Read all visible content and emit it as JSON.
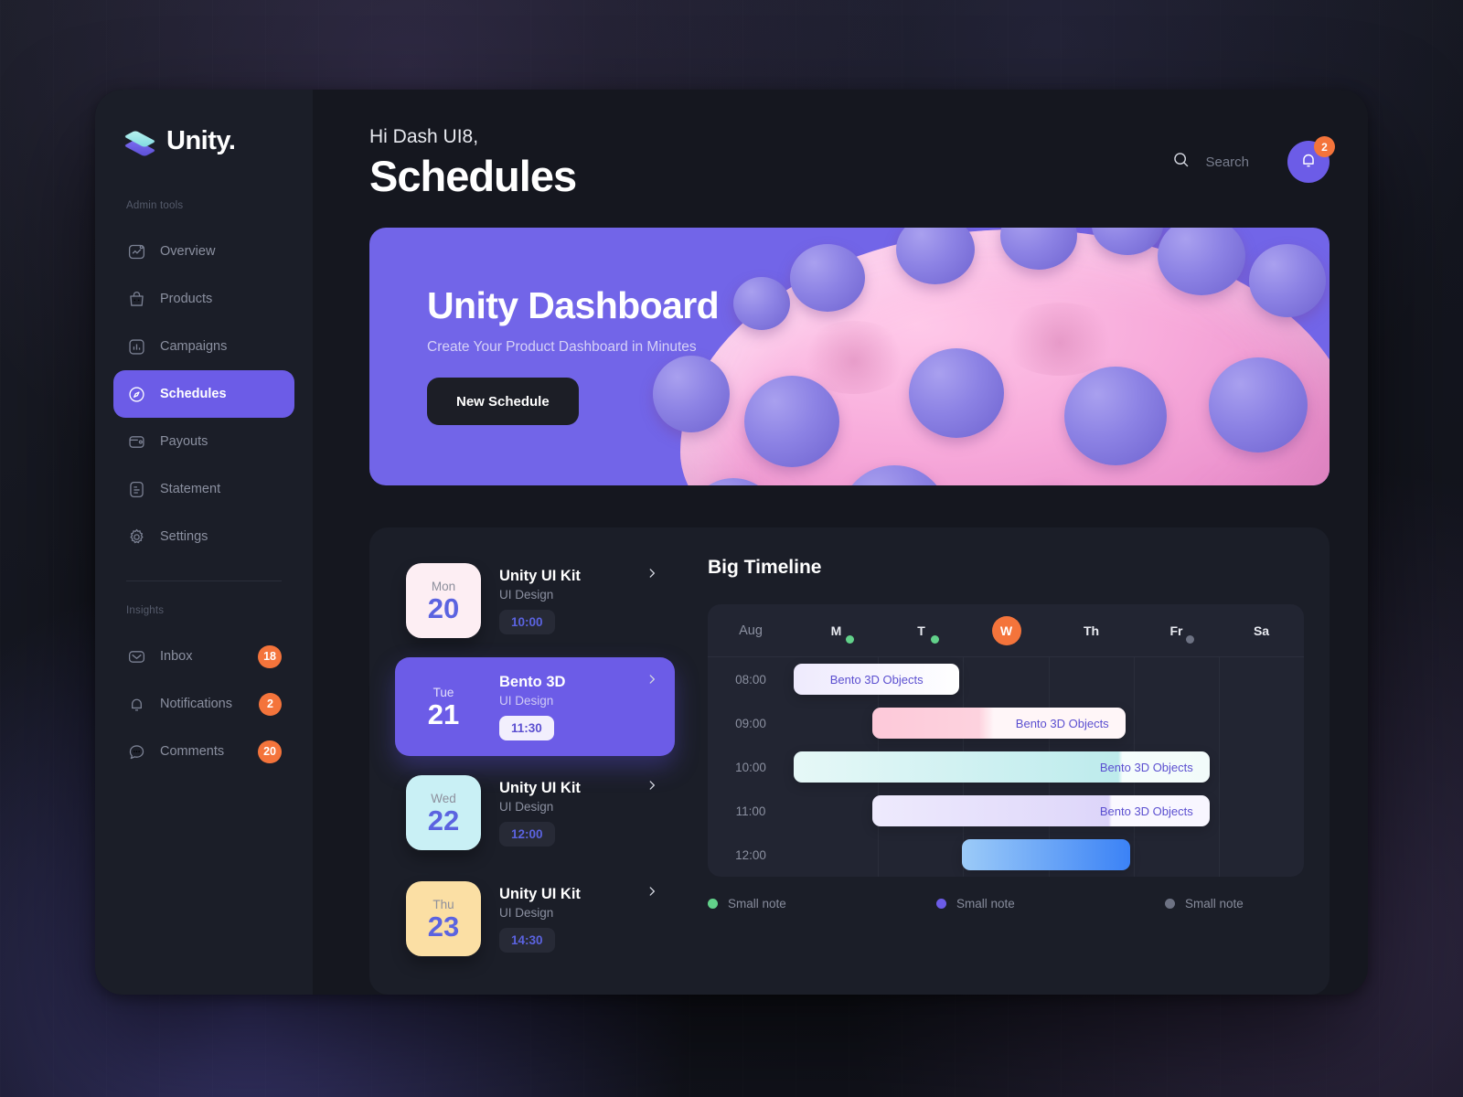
{
  "brand": {
    "name": "Unity.",
    "logo_icon": "layers-icon"
  },
  "sidebar": {
    "admin_label": "Admin tools",
    "admin_items": [
      {
        "label": "Overview",
        "icon": "chart-frame-icon",
        "active": false
      },
      {
        "label": "Products",
        "icon": "bag-icon",
        "active": false
      },
      {
        "label": "Campaigns",
        "icon": "bar-chart-icon",
        "active": false
      },
      {
        "label": "Schedules",
        "icon": "compass-icon",
        "active": true
      },
      {
        "label": "Payouts",
        "icon": "wallet-icon",
        "active": false
      },
      {
        "label": "Statement",
        "icon": "document-icon",
        "active": false
      },
      {
        "label": "Settings",
        "icon": "gear-icon",
        "active": false
      }
    ],
    "insights_label": "Insights",
    "insights_items": [
      {
        "label": "Inbox",
        "icon": "envelope-icon",
        "badge": "18"
      },
      {
        "label": "Notifications",
        "icon": "bell-icon",
        "badge": "2"
      },
      {
        "label": "Comments",
        "icon": "chat-icon",
        "badge": "20"
      }
    ]
  },
  "header": {
    "greeting": "Hi Dash UI8,",
    "title": "Schedules",
    "search_placeholder": "Search",
    "notification_count": "2"
  },
  "hero": {
    "title": "Unity Dashboard",
    "subtitle": "Create Your Product Dashboard in Minutes",
    "button": "New Schedule",
    "bg_color": "#7265e8",
    "blob_color": "#f7a9da",
    "ball_color": "#8c82e4"
  },
  "schedules": [
    {
      "dow": "Mon",
      "day": "20",
      "title": "Unity UI Kit",
      "subtitle": "UI Design",
      "time": "10:00",
      "tile_color": "#fdeef3",
      "selected": false
    },
    {
      "dow": "Tue",
      "day": "21",
      "title": "Bento 3D",
      "subtitle": "UI Design",
      "time": "11:30",
      "tile_color": "#6c5ce7",
      "selected": true
    },
    {
      "dow": "Wed",
      "day": "22",
      "title": "Unity UI Kit",
      "subtitle": "UI Design",
      "time": "12:00",
      "tile_color": "#c9f0f5",
      "selected": false
    },
    {
      "dow": "Thu",
      "day": "23",
      "title": "Unity UI Kit",
      "subtitle": "UI Design",
      "time": "14:30",
      "tile_color": "#fbdfa4",
      "selected": false
    }
  ],
  "timeline": {
    "title": "Big Timeline",
    "month": "Aug",
    "days": [
      {
        "label": "M",
        "dot": "#62d18a",
        "today": false
      },
      {
        "label": "T",
        "dot": "#62d18a",
        "today": false
      },
      {
        "label": "W",
        "dot": null,
        "today": true
      },
      {
        "label": "Th",
        "dot": null,
        "today": false
      },
      {
        "label": "Fr",
        "dot": "#6d7283",
        "today": false
      },
      {
        "label": "Sa",
        "dot": null,
        "today": false
      }
    ],
    "hours": [
      "08:00",
      "09:00",
      "10:00",
      "11:00",
      "12:00"
    ],
    "events": [
      {
        "row": 0,
        "label": "Bento 3D Objects",
        "left_pct": 0,
        "width_pct": 32.5,
        "from": "#eeeafd",
        "to": "#ffffff",
        "label_pos": "center"
      },
      {
        "row": 1,
        "label": "Bento 3D Objects",
        "left_pct": 15.5,
        "width_pct": 49.5,
        "from": "#fdc9d9",
        "to": "#fff6f8",
        "label_pos": "right"
      },
      {
        "row": 2,
        "label": "Bento 3D Objects",
        "left_pct": 0,
        "width_pct": 81.5,
        "from": "#d7f3f3",
        "to": "#f3fcfb",
        "label_pos": "right"
      },
      {
        "row": 3,
        "label": "Bento 3D Objects",
        "left_pct": 15.5,
        "width_pct": 66,
        "from": "#e7e2fb",
        "to": "#faf8ff",
        "label_pos": "right"
      },
      {
        "row": 4,
        "label": "",
        "left_pct": 33,
        "width_pct": 33,
        "from": "#8fc6f7",
        "to": "#3b82f6",
        "label_pos": "none"
      }
    ],
    "legend": [
      {
        "label": "Small note",
        "color": "#62d18a"
      },
      {
        "label": "Small note",
        "color": "#6c5ce7"
      },
      {
        "label": "Small note",
        "color": "#6d7283"
      }
    ]
  }
}
